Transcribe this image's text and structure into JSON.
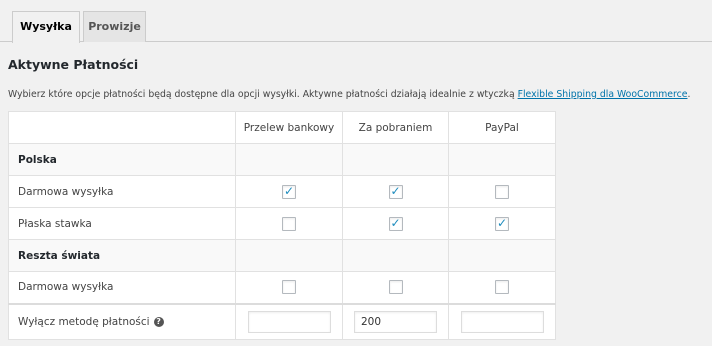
{
  "tabs": [
    {
      "label": "Wysyłka",
      "active": true
    },
    {
      "label": "Prowizje",
      "active": false
    }
  ],
  "section_title": "Aktywne Płatności",
  "description": {
    "text": "Wybierz które opcje płatności będą dostępne dla opcji wysyłki. Aktywne płatności działają idealnie z wtyczką ",
    "link_text": "Flexible Shipping dla WooCommerce",
    "suffix": "."
  },
  "columns": [
    "",
    "Przelew bankowy",
    "Za pobraniem",
    "PayPal"
  ],
  "groups": [
    {
      "name": "Polska",
      "methods": [
        {
          "label": "Darmowa wysyłka",
          "checks": [
            true,
            true,
            false
          ]
        },
        {
          "label": "Płaska stawka",
          "checks": [
            false,
            true,
            true
          ]
        }
      ]
    },
    {
      "name": "Reszta świata",
      "methods": [
        {
          "label": "Darmowa wysyłka",
          "checks": [
            false,
            false,
            false
          ]
        }
      ]
    }
  ],
  "disable_row": {
    "label": "Wyłącz metodę płatności",
    "help_icon": "help-icon",
    "values": [
      "",
      "200",
      ""
    ]
  },
  "colors": {
    "accent": "#0073aa",
    "check": "#1e8cbe",
    "background": "#f1f1f1"
  }
}
